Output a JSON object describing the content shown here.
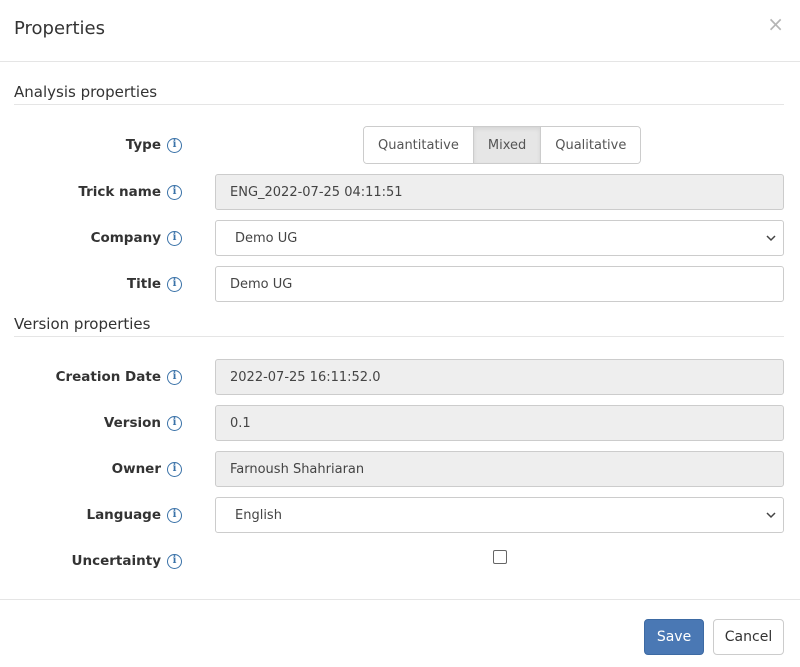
{
  "dialog": {
    "title": "Properties",
    "close_glyph": "×"
  },
  "sections": {
    "analysis": "Analysis properties",
    "version": "Version properties"
  },
  "fields": {
    "type": {
      "label": "Type",
      "options": [
        "Quantitative",
        "Mixed",
        "Qualitative"
      ],
      "selected": "Mixed"
    },
    "trick_name": {
      "label": "Trick name",
      "value": "ENG_2022-07-25 04:11:51"
    },
    "company": {
      "label": "Company",
      "value": "Demo UG"
    },
    "title": {
      "label": "Title",
      "value": "Demo UG"
    },
    "creation_date": {
      "label": "Creation Date",
      "value": "2022-07-25 16:11:52.0"
    },
    "version": {
      "label": "Version",
      "value": "0.1"
    },
    "owner": {
      "label": "Owner",
      "value": "Farnoush Shahriaran"
    },
    "language": {
      "label": "Language",
      "value": "English"
    },
    "uncertainty": {
      "label": "Uncertainty",
      "checked": false
    }
  },
  "info_glyph": "i",
  "footer": {
    "save_label": "Save",
    "cancel_label": "Cancel"
  },
  "colors": {
    "primary": "#4a78b4",
    "info": "#3a72a8",
    "readonly_bg": "#eeeeee"
  }
}
